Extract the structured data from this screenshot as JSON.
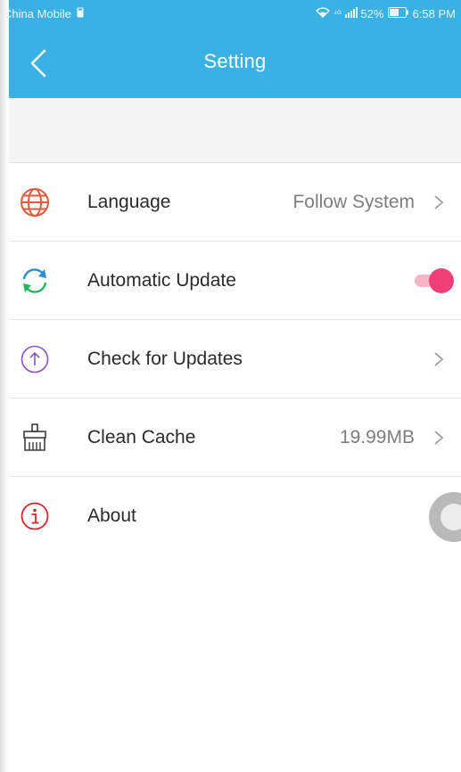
{
  "status_bar": {
    "carrier": "China Mobile",
    "signal_text": "⁴ᴳ",
    "battery_percent": "52%",
    "time": "6:58 PM"
  },
  "app_bar": {
    "title": "Setting"
  },
  "settings": [
    {
      "label": "Language",
      "value": "Follow System",
      "icon": "globe-icon",
      "has_chevron": true
    },
    {
      "label": "Automatic Update",
      "toggle_on": true,
      "icon": "sync-icon"
    },
    {
      "label": "Check for Updates",
      "icon": "upload-arrow-icon",
      "has_chevron": true
    },
    {
      "label": "Clean Cache",
      "value": "19.99MB",
      "icon": "broom-icon",
      "has_chevron": true
    },
    {
      "label": "About",
      "icon": "info-icon",
      "has_chevron": true
    }
  ],
  "colors": {
    "primary": "#3ab1e2",
    "toggle_on": "#ef3e78",
    "globe_icon": "#e05a3c",
    "sync_icon_green": "#1cb95b",
    "sync_icon_blue": "#2b8fd6",
    "upload_icon": "#8a56c4",
    "broom_icon": "#3d3d3d",
    "info_icon": "#d9262b"
  }
}
